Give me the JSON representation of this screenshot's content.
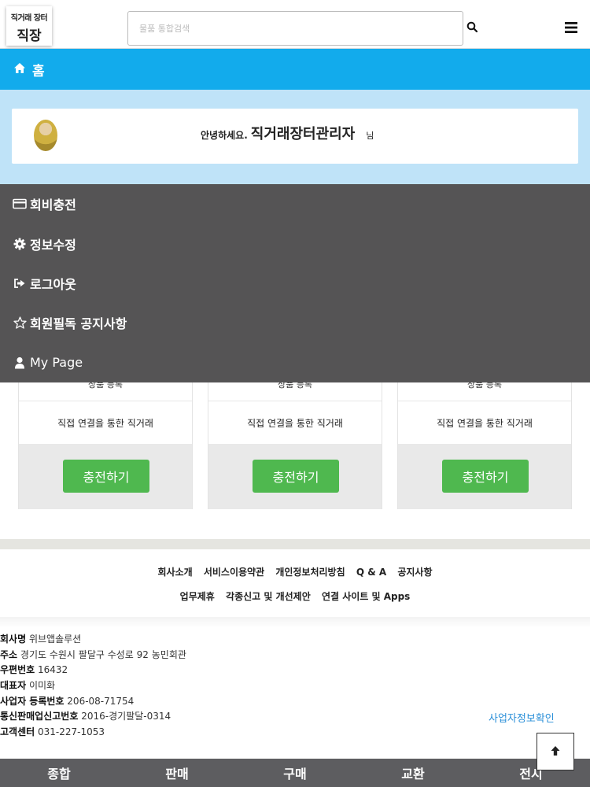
{
  "header": {
    "logo_small": "직거래 장터",
    "logo_big": "직장",
    "search_placeholder": "물품 통합검색",
    "search_icon": "search-icon",
    "menu_icon": "hamburger-icon"
  },
  "homebar": {
    "icon": "home-icon",
    "label": "홈"
  },
  "welcome": {
    "greeting": "안녕하세요.",
    "username": "직거래장터관리자",
    "suffix": "님"
  },
  "menu": {
    "items": [
      {
        "icon": "credit-card-icon",
        "label": "회비충전"
      },
      {
        "icon": "gear-icon",
        "label": "정보수정"
      },
      {
        "icon": "logout-icon",
        "label": "로그아웃"
      },
      {
        "icon": "star-icon",
        "label": "회원필독 공지사항"
      },
      {
        "icon": "user-icon",
        "label": "My Page"
      }
    ]
  },
  "cards": [
    {
      "strip": "상품 등록",
      "description": "직접 연결을 통한 직거래",
      "button": "충전하기"
    },
    {
      "strip": "상품 등록",
      "description": "직접 연결을 통한 직거래",
      "button": "충전하기"
    },
    {
      "strip": "상품 등록",
      "description": "직접 연결을 통한 직거래",
      "button": "충전하기"
    }
  ],
  "footer_links": {
    "row1": [
      "회사소개",
      "서비스이용약관",
      "개인정보처리방침",
      "Q & A",
      "공지사항"
    ],
    "row2": [
      "업무제휴",
      "각종신고 및 개선제안",
      "연결 사이트 및 Apps"
    ]
  },
  "company": [
    {
      "key": "회사명",
      "value": "위브앱솔루션"
    },
    {
      "key": "주소",
      "value": "경기도 수원시 팔달구 수성로 92 농민회관"
    },
    {
      "key": "우편번호",
      "value": "16432"
    },
    {
      "key": "대표자",
      "value": "이미화"
    },
    {
      "key": "사업자 등록번호",
      "value": "206-08-71754"
    },
    {
      "key": "통신판매업신고번호",
      "value": "2016-경기팔달-0314"
    },
    {
      "key": "고객센터",
      "value": "031-227-1053"
    }
  ],
  "biz_check": "사업자정보확인",
  "top_button_icon": "arrow-up-icon",
  "bottom_nav": [
    "종합",
    "판매",
    "구매",
    "교환",
    "전시"
  ],
  "colors": {
    "home_bar": "#12abec",
    "welcome_bg": "#bfe3f8",
    "menu_bg": "#555455",
    "charge_button": "#4fb84f",
    "bottom_nav": "#5d5d60",
    "link": "#2a8fd8"
  }
}
